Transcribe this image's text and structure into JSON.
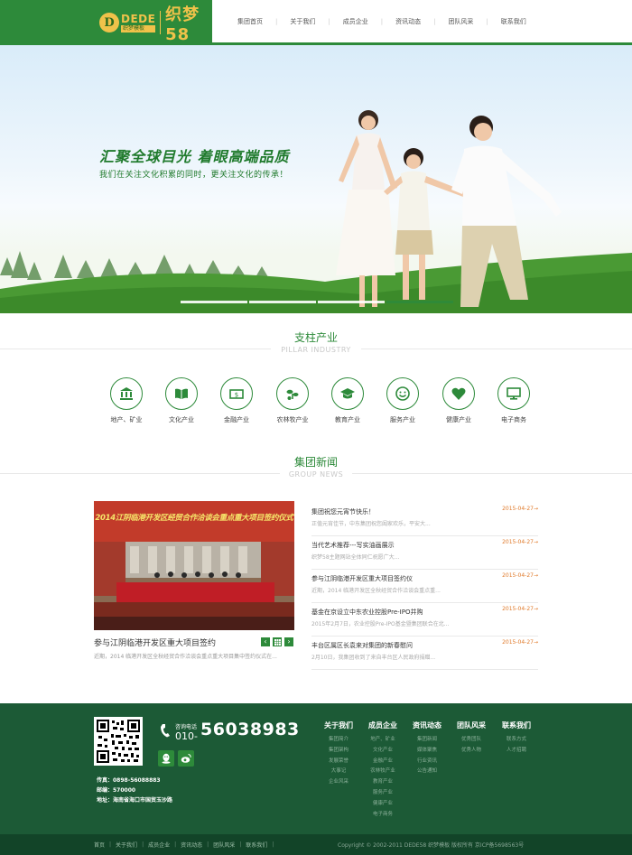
{
  "logo": {
    "mark": "D",
    "brand": "DEDE",
    "brand_sub": "织梦模板",
    "title": "织梦58"
  },
  "nav": {
    "items": [
      "集团首页",
      "关于我们",
      "成员企业",
      "资讯动态",
      "团队风采",
      "联系我们"
    ]
  },
  "banner": {
    "title": "汇聚全球目光 着眼高端品质",
    "subtitle": "我们在关注文化积累的同时，更关注文化的传承！",
    "slides": 4,
    "active_slide": 4
  },
  "industry": {
    "title": "支柱产业",
    "title_en": "PILLAR INDUSTRY",
    "items": [
      {
        "label": "地产、矿业",
        "icon": "bank-icon"
      },
      {
        "label": "文化产业",
        "icon": "book-icon"
      },
      {
        "label": "金融产业",
        "icon": "money-icon"
      },
      {
        "label": "农林牧产业",
        "icon": "sprout-icon"
      },
      {
        "label": "教育产业",
        "icon": "graduation-cap-icon"
      },
      {
        "label": "服务产业",
        "icon": "smile-icon"
      },
      {
        "label": "健康产业",
        "icon": "heart-icon"
      },
      {
        "label": "电子商务",
        "icon": "monitor-icon"
      }
    ]
  },
  "news": {
    "title": "集团新闻",
    "title_en": "GROUP NEWS",
    "featured": {
      "banner_text": "2014江阴临港开发区经贸合作洽谈会重点重大项目签约仪式",
      "caption": "参与江阴临港开发区重大项目签约",
      "desc": "近期，2014 临港开发区全秋经贸合作洽谈会重点重大项目集中签约仪式在..."
    },
    "items": [
      {
        "title": "集团祝您元宵节快乐！",
        "desc": "正值元宵佳节，中东集团祝您阖家欢乐，平安大...",
        "date": "2015-04-27→"
      },
      {
        "title": "当代艺术推荐---写实油画展示",
        "desc": "织梦58主题网站全体同仁祝愿广大...",
        "date": "2015-04-27→"
      },
      {
        "title": "参与江阴临港开发区重大项目签约仪",
        "desc": "近期，2014 临港开发区全秋经贸合作洽谈会重点重...",
        "date": "2015-04-27→"
      },
      {
        "title": "基金在京设立中东农业控股Pre-IPO并购",
        "desc": "2015年2月7日，农业控股Pre-IPO基金暨集团联合在北...",
        "date": "2015-04-27→"
      },
      {
        "title": "丰台区属区长袁来对集团的新春慰问",
        "desc": "2月10日，我集团收到了来自丰台区人民政府捐赠...",
        "date": "2015-04-27→"
      }
    ]
  },
  "footer": {
    "phone_label": "咨询电话",
    "phone_prefix": "010-",
    "phone_number": "56038983",
    "fax": "传真：0898-56088883",
    "postcode": "邮编：570000",
    "address": "地址：海南省海口市国贸玉沙路",
    "columns": [
      {
        "heading": "关于我们",
        "links": [
          "集团简介",
          "集团架构",
          "发展荣誉",
          "大事记",
          "企业风采"
        ]
      },
      {
        "heading": "成员企业",
        "links": [
          "地产、矿业",
          "文化产业",
          "金融产业",
          "农林牧产业",
          "教育产业",
          "服务产业",
          "健康产业",
          "电子商务"
        ]
      },
      {
        "heading": "资讯动态",
        "links": [
          "集团新闻",
          "媒体聚焦",
          "行业资讯",
          "公告通知"
        ]
      },
      {
        "heading": "团队风采",
        "links": [
          "优秀团队",
          "优秀人物"
        ]
      },
      {
        "heading": "联系我们",
        "links": [
          "联系方式",
          "人才招聘"
        ]
      }
    ]
  },
  "bottom": {
    "links": [
      "首页",
      "关于我们",
      "成员企业",
      "资讯动态",
      "团队风采",
      "联系我们"
    ],
    "copyright": "Copyright © 2002-2011 DEDE58 织梦模板 版权所有 京ICP备5698563号"
  },
  "colors": {
    "brand_green": "#2d8a3a",
    "footer_green": "#1c5a36",
    "date_orange": "#e07a2a",
    "logo_gold": "#f0c24a"
  }
}
